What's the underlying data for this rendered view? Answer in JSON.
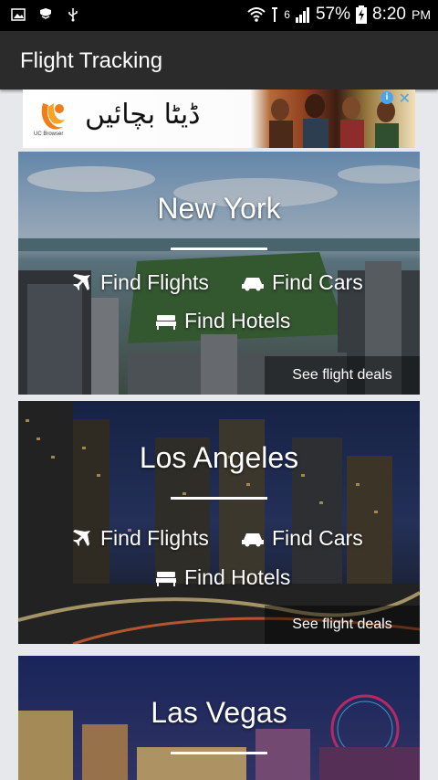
{
  "status_bar": {
    "network": "6",
    "battery": "57%",
    "time": "8:20",
    "ampm": "PM"
  },
  "app_bar": {
    "title": "Flight Tracking"
  },
  "ad": {
    "headline": "ڈیٹا بچائیں",
    "brand": "UC Browser"
  },
  "cities": [
    {
      "name": "New York",
      "find_flights": "Find Flights",
      "find_cars": "Find Cars",
      "find_hotels": "Find Hotels",
      "deals": "See flight deals"
    },
    {
      "name": "Los Angeles",
      "find_flights": "Find Flights",
      "find_cars": "Find Cars",
      "find_hotels": "Find Hotels",
      "deals": "See flight deals"
    },
    {
      "name": "Las Vegas"
    }
  ]
}
